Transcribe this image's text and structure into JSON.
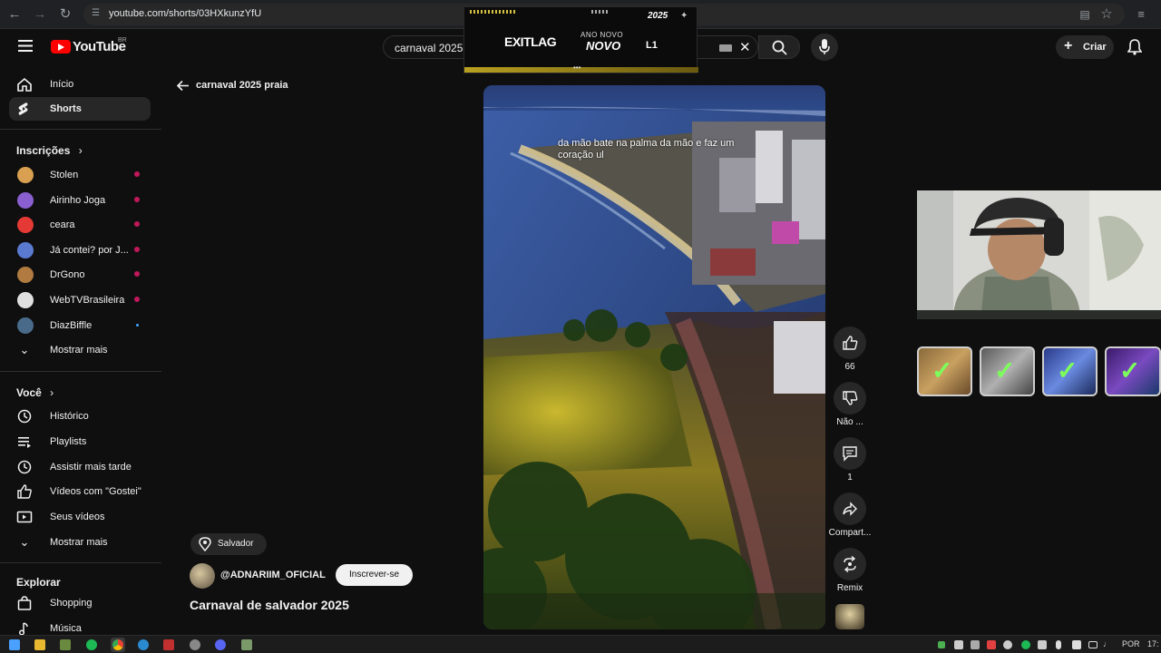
{
  "browser": {
    "url": "youtube.com/shorts/03HXkunzYfU"
  },
  "header": {
    "brand": "YouTube",
    "country": "BR",
    "search_value": "carnaval 2025",
    "create_label": "Criar"
  },
  "ad": {
    "brand": "EXITLAG",
    "line1": "ANO NOVO",
    "line2": "NOVO",
    "year": "2025"
  },
  "sidebar": {
    "main": [
      {
        "label": "Início",
        "icon": "home-icon"
      },
      {
        "label": "Shorts",
        "icon": "shorts-icon"
      }
    ],
    "subscriptions_title": "Inscrições",
    "subscriptions": [
      {
        "label": "Stolen",
        "color": "#d8a050",
        "live": true
      },
      {
        "label": "Airinho Joga",
        "color": "#8a5fd0",
        "live": true
      },
      {
        "label": "ceara",
        "color": "#e53935",
        "live": true
      },
      {
        "label": "Já contei? por J...",
        "color": "#5a7ad0",
        "live": true
      },
      {
        "label": "DrGono",
        "color": "#b07a40",
        "live": true
      },
      {
        "label": "WebTVBrasileira",
        "color": "#e0e0e0",
        "live": true
      },
      {
        "label": "DiazBiffle",
        "color": "#4a6a8a",
        "live": false
      }
    ],
    "show_more_1": "Mostrar mais",
    "you_title": "Você",
    "you_items": [
      {
        "label": "Histórico",
        "icon": "history-icon"
      },
      {
        "label": "Playlists",
        "icon": "playlists-icon"
      },
      {
        "label": "Assistir mais tarde",
        "icon": "clock-icon"
      },
      {
        "label": "Vídeos com \"Gostei\"",
        "icon": "like-icon"
      },
      {
        "label": "Seus vídeos",
        "icon": "video-icon"
      }
    ],
    "show_more_2": "Mostrar mais",
    "explore_title": "Explorar",
    "explore_items": [
      {
        "label": "Shopping",
        "icon": "shopping-icon"
      },
      {
        "label": "Música",
        "icon": "music-icon"
      }
    ]
  },
  "main": {
    "back_title": "carnaval 2025 praia",
    "caption": "da mão bate na palma da mão e faz um coração ul",
    "location": "Salvador",
    "channel": "@ADNARIIM_OFICIAL",
    "subscribe_label": "Inscrever-se",
    "title": "Carnaval de salvador 2025"
  },
  "actions": {
    "like_count": "66",
    "dislike_label": "Não ...",
    "comment_count": "1",
    "share_label": "Compart...",
    "remix_label": "Remix"
  },
  "taskbar": {
    "lang": "POR",
    "time": "17:"
  }
}
